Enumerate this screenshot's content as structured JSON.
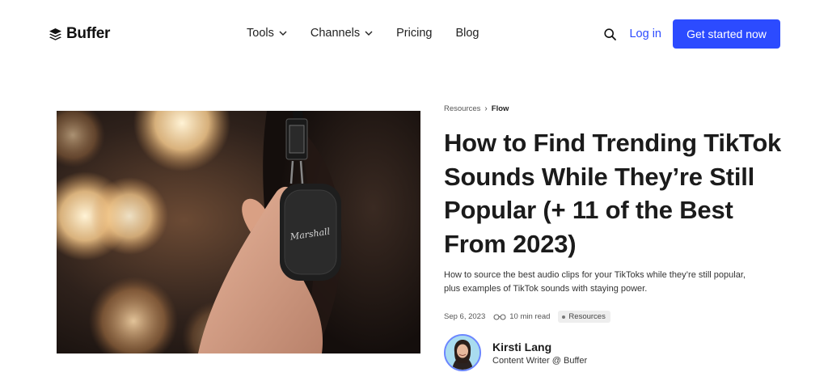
{
  "header": {
    "logo_text": "Buffer",
    "nav": [
      {
        "label": "Tools",
        "has_dropdown": true
      },
      {
        "label": "Channels",
        "has_dropdown": true
      },
      {
        "label": "Pricing",
        "has_dropdown": false
      },
      {
        "label": "Blog",
        "has_dropdown": false
      }
    ],
    "login_label": "Log in",
    "cta_label": "Get started now",
    "accent_color": "#2c4bff"
  },
  "article": {
    "breadcrumb": [
      "Resources",
      "Flow"
    ],
    "title": "How to Find Trending TikTok Sounds While They’re Still Popular (+ 11 of the Best From 2023)",
    "subtitle": "How to source the best audio clips for your TikToks while they’re still popular, plus examples of TikTok sounds with staying power.",
    "date": "Sep 6, 2023",
    "read_time": "10 min read",
    "tag": "Resources",
    "author": {
      "name": "Kirsti Lang",
      "role": "Content Writer @ Buffer"
    }
  },
  "hero_image": {
    "headphone_brand": "Marshall"
  },
  "icons": {
    "logo": "buffer-stack-icon",
    "search": "search-icon",
    "chevron": "chevron-down-icon",
    "read": "glasses-icon"
  }
}
